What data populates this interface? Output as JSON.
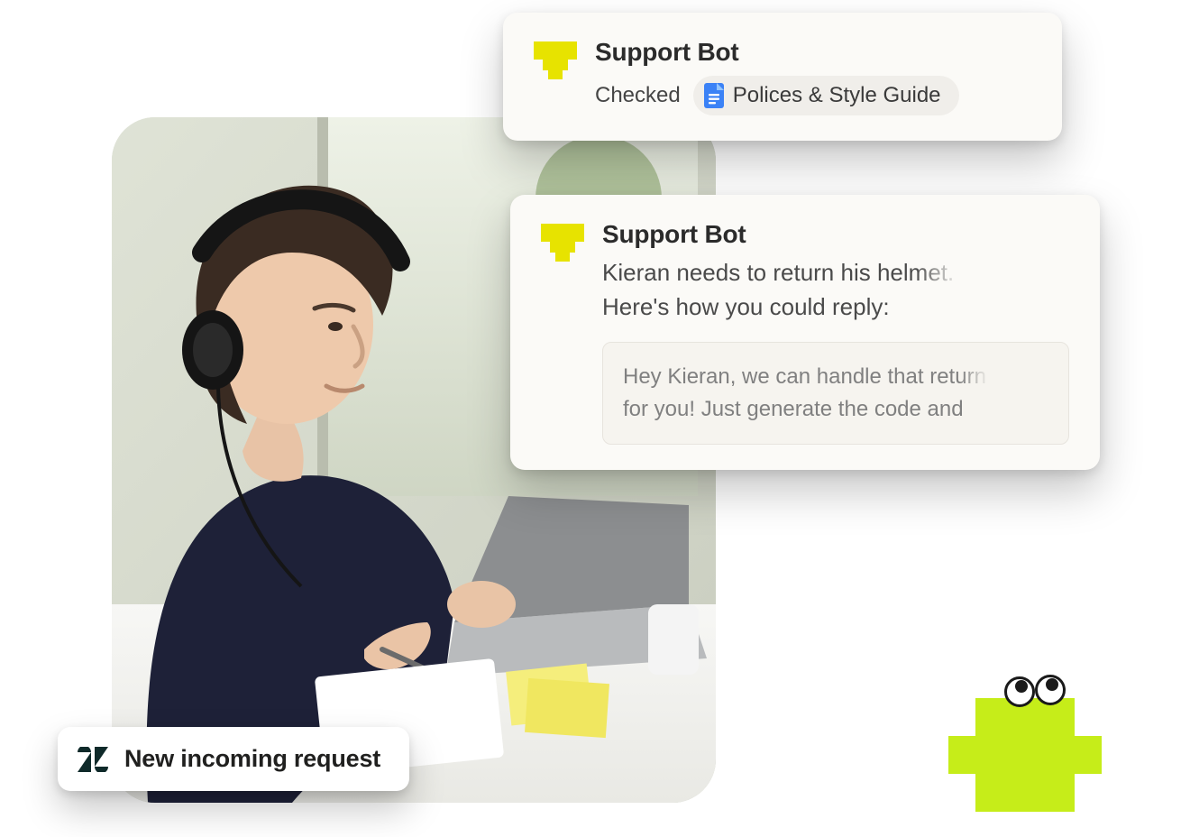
{
  "toast": {
    "label": "New incoming request",
    "icon_name": "zendesk-icon"
  },
  "card_checked": {
    "bot_name": "Support Bot",
    "status_label": "Checked",
    "chip": {
      "label": "Polices & Style Guide",
      "icon_name": "google-doc-icon",
      "icon_color": "#3b82f6"
    }
  },
  "card_suggest": {
    "bot_name": "Support Bot",
    "desc_line1_full": "Kieran needs to return his helmet.",
    "desc_line1_solid": "Kieran needs to return his ",
    "desc_line1_fade": "helmet.",
    "desc_line2": "Here's how you could reply:",
    "reply_line1_solid": "Hey Kieran, we can handle that ",
    "reply_line1_fade": "return",
    "reply_line2": "for you! Just generate the code and"
  },
  "colors": {
    "avatar_yellow": "#e7e300",
    "mascot_green": "#c6ed19",
    "card_bg": "#fbfaf7",
    "chip_bg": "#f0eeea"
  }
}
